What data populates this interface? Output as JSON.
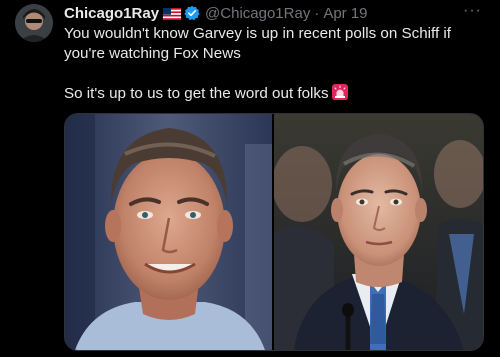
{
  "post": {
    "display_name": "Chicago1Ray",
    "handle": "@Chicago1Ray",
    "separator": "·",
    "date": "Apr 19",
    "more_label": "···",
    "text_line1": "You wouldn't know Garvey is up in recent polls on Schiff if you're watching Fox News",
    "text_line2": "So it's up to us to get the word out folks",
    "icons": {
      "flag": "us-flag-icon",
      "verified": "verified-badge-icon",
      "siren": "siren-emoji-icon",
      "more": "more-options-icon"
    }
  },
  "colors": {
    "background": "#000000",
    "text": "#e7e9ea",
    "muted": "#71767b",
    "verified": "#1d9bf0",
    "siren": "#e0245e"
  }
}
